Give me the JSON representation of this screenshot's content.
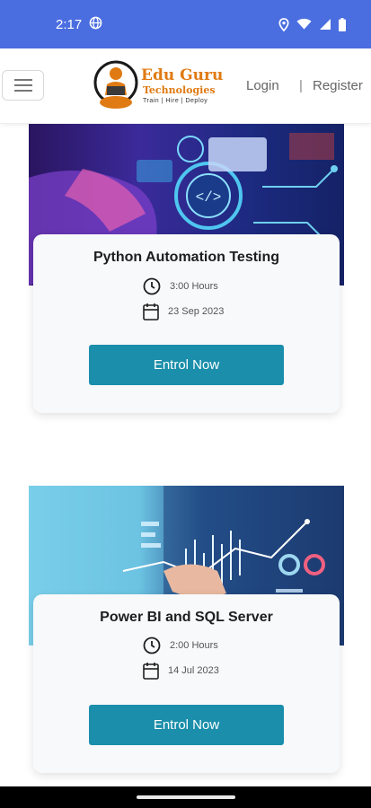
{
  "status_bar": {
    "time": "2:17",
    "icons": [
      "globe-icon",
      "location-icon",
      "wifi-icon",
      "signal-icon",
      "battery-icon"
    ]
  },
  "header": {
    "logo": {
      "line1": "Edu Guru",
      "line2": "Technologies",
      "tagline": "Train | Hire | Deploy"
    },
    "login_label": "Login",
    "separator": "|",
    "register_label": "Register"
  },
  "courses": [
    {
      "title": "Python Automation Testing",
      "duration": "3:00 Hours",
      "date": "23 Sep 2023",
      "button_label": "Entrol Now"
    },
    {
      "title": "Power BI and SQL Server",
      "duration": "2:00 Hours",
      "date": "14 Jul 2023",
      "button_label": "Entrol Now"
    }
  ],
  "colors": {
    "status_bar": "#4a6ee0",
    "accent": "#1a8eaa",
    "logo": "#e07a13"
  }
}
